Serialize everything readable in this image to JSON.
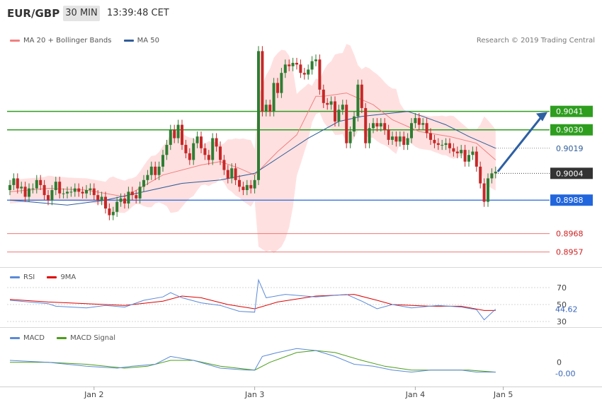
{
  "header": {
    "symbol": "EUR/GBP",
    "timeframe": "30 MIN",
    "time": "13:39:48 CET"
  },
  "legend": {
    "ma20": "MA 20 + Bollinger Bands",
    "ma50": "MA 50",
    "copyright": "Research © 2019 Trading Central"
  },
  "rsi_legend": {
    "rsi": "RSI",
    "ma9": "9MA"
  },
  "macd_legend": {
    "macd": "MACD",
    "signal": "MACD Signal"
  },
  "colors": {
    "up": "#2e7d32",
    "down": "#c62828",
    "ma20": "#f08080",
    "band": "#ffd6d6",
    "ma50": "#2f5c99",
    "green_level": "#2e9e1f",
    "red_level": "#ee7777",
    "support": "#2266dd",
    "arrow": "#2d5fa3",
    "rsi": "#5b8ad8",
    "rsi_ma": "#e00000",
    "macd": "#5b8ad8",
    "macd_signal": "#4c9e1a"
  },
  "chart_data": [
    {
      "type": "candlestick",
      "name": "EUR/GBP",
      "ylim": [
        0.8948,
        0.9078
      ],
      "x_tick_labels": [
        "Jan 2",
        "Jan 3",
        "Jan 4",
        "Jan 5"
      ],
      "levels": [
        {
          "value": 0.9041,
          "label": "0.9041",
          "style": "green"
        },
        {
          "value": 0.903,
          "label": "0.9030",
          "style": "green"
        },
        {
          "value": 0.9019,
          "label": "0.9019",
          "style": "dotted"
        },
        {
          "value": 0.9004,
          "label": "0.9004",
          "style": "current"
        },
        {
          "value": 0.8988,
          "label": "0.8988",
          "style": "support"
        },
        {
          "value": 0.8968,
          "label": "0.8968",
          "style": "red"
        },
        {
          "value": 0.8957,
          "label": "0.8957",
          "style": "red"
        }
      ],
      "closes": [
        0.8997,
        0.9001,
        0.8995,
        0.8996,
        0.899,
        0.8995,
        0.8995,
        0.9,
        0.8997,
        0.8991,
        0.8988,
        0.8994,
        0.8999,
        0.8992,
        0.8992,
        0.8993,
        0.8993,
        0.8995,
        0.8993,
        0.8992,
        0.8994,
        0.8995,
        0.8991,
        0.8988,
        0.899,
        0.8983,
        0.8979,
        0.8981,
        0.8987,
        0.8989,
        0.8986,
        0.8993,
        0.8991,
        0.8989,
        0.8996,
        0.9,
        0.9003,
        0.9008,
        0.9003,
        0.9008,
        0.9015,
        0.9021,
        0.903,
        0.9025,
        0.9033,
        0.9021,
        0.9016,
        0.9012,
        0.9022,
        0.9026,
        0.9019,
        0.9015,
        0.9012,
        0.9025,
        0.902,
        0.9012,
        0.9006,
        0.9001,
        0.9007,
        0.9,
        0.8996,
        0.8994,
        0.8997,
        0.8995,
        0.9,
        0.9077,
        0.9041,
        0.9045,
        0.9041,
        0.9058,
        0.9052,
        0.9064,
        0.9069,
        0.9068,
        0.907,
        0.9069,
        0.9064,
        0.9063,
        0.9066,
        0.9071,
        0.9072,
        0.9054,
        0.9046,
        0.9045,
        0.9047,
        0.9035,
        0.9042,
        0.9045,
        0.9022,
        0.9029,
        0.9038,
        0.9057,
        0.9043,
        0.9022,
        0.9031,
        0.9034,
        0.9032,
        0.9034,
        0.903,
        0.9024,
        0.9026,
        0.9023,
        0.9026,
        0.9021,
        0.9025,
        0.9034,
        0.9037,
        0.9033,
        0.9034,
        0.9028,
        0.9024,
        0.9022,
        0.9021,
        0.9021,
        0.9022,
        0.9019,
        0.9017,
        0.9016,
        0.9018,
        0.9011,
        0.9015,
        0.9017,
        0.9008,
        0.8998,
        0.8987,
        0.9001,
        0.9004,
        0.9005
      ],
      "ma20_points": [
        [
          0,
          0.8993
        ],
        [
          10,
          0.8995
        ],
        [
          20,
          0.8994
        ],
        [
          30,
          0.899
        ],
        [
          40,
          0.9003
        ],
        [
          50,
          0.9009
        ],
        [
          55,
          0.9011
        ],
        [
          60,
          0.9007
        ],
        [
          64,
          0.9003
        ],
        [
          70,
          0.9017
        ],
        [
          75,
          0.9027
        ],
        [
          80,
          0.905
        ],
        [
          82,
          0.905
        ],
        [
          88,
          0.9052
        ],
        [
          95,
          0.9045
        ],
        [
          100,
          0.9036
        ],
        [
          107,
          0.9029
        ],
        [
          115,
          0.9026
        ],
        [
          122,
          0.9022
        ],
        [
          127,
          0.9012
        ]
      ],
      "ma50_points": [
        [
          0,
          0.8988
        ],
        [
          15,
          0.8985
        ],
        [
          25,
          0.8988
        ],
        [
          35,
          0.8993
        ],
        [
          45,
          0.8998
        ],
        [
          55,
          0.9
        ],
        [
          64,
          0.9004
        ],
        [
          70,
          0.9013
        ],
        [
          78,
          0.9025
        ],
        [
          86,
          0.9035
        ],
        [
          92,
          0.9038
        ],
        [
          100,
          0.904
        ],
        [
          104,
          0.9041
        ],
        [
          108,
          0.9038
        ],
        [
          114,
          0.9033
        ],
        [
          120,
          0.9026
        ],
        [
          127,
          0.9019
        ]
      ]
    },
    {
      "type": "line",
      "name": "RSI",
      "ylim": [
        25,
        80
      ],
      "y_ticks": [
        30,
        50,
        70
      ],
      "current": "44.62",
      "rsi_points": [
        [
          0,
          55
        ],
        [
          10,
          51
        ],
        [
          12,
          48
        ],
        [
          20,
          46
        ],
        [
          25,
          49
        ],
        [
          30,
          47
        ],
        [
          35,
          55
        ],
        [
          40,
          59
        ],
        [
          42,
          64
        ],
        [
          45,
          58
        ],
        [
          50,
          52
        ],
        [
          55,
          49
        ],
        [
          60,
          42
        ],
        [
          64,
          41
        ],
        [
          65,
          79
        ],
        [
          67,
          58
        ],
        [
          72,
          62
        ],
        [
          80,
          59
        ],
        [
          88,
          62
        ],
        [
          92,
          54
        ],
        [
          96,
          45
        ],
        [
          100,
          50
        ],
        [
          105,
          46
        ],
        [
          112,
          49
        ],
        [
          118,
          47
        ],
        [
          122,
          44
        ],
        [
          124,
          32
        ],
        [
          127,
          44.62
        ]
      ],
      "ma_points": [
        [
          0,
          56
        ],
        [
          10,
          53
        ],
        [
          20,
          51
        ],
        [
          30,
          49
        ],
        [
          40,
          54
        ],
        [
          45,
          60
        ],
        [
          50,
          58
        ],
        [
          57,
          50
        ],
        [
          64,
          45
        ],
        [
          70,
          53
        ],
        [
          80,
          60
        ],
        [
          90,
          62
        ],
        [
          96,
          55
        ],
        [
          100,
          50
        ],
        [
          110,
          48
        ],
        [
          118,
          48
        ],
        [
          124,
          43
        ],
        [
          127,
          43
        ]
      ]
    },
    {
      "type": "line",
      "name": "MACD",
      "ylim": [
        -0.0012,
        0.001
      ],
      "y_ticks": [
        {
          "value": 0,
          "label": "0"
        }
      ],
      "current": "-0.00",
      "macd_points": [
        [
          0,
          0.0001
        ],
        [
          10,
          0
        ],
        [
          20,
          -0.0002
        ],
        [
          28,
          -0.0003
        ],
        [
          32,
          -0.0002
        ],
        [
          38,
          -0.0001
        ],
        [
          42,
          0.0003
        ],
        [
          45,
          0.0002
        ],
        [
          48,
          0.0001
        ],
        [
          55,
          -0.0003
        ],
        [
          62,
          -0.0004
        ],
        [
          64,
          -0.0004
        ],
        [
          66,
          0.0003
        ],
        [
          70,
          0.0005
        ],
        [
          75,
          0.0007
        ],
        [
          80,
          0.0006
        ],
        [
          85,
          0.0003
        ],
        [
          90,
          -0.0001
        ],
        [
          95,
          -0.0002
        ],
        [
          100,
          -0.0004
        ],
        [
          105,
          -0.0005
        ],
        [
          110,
          -0.0004
        ],
        [
          118,
          -0.0004
        ],
        [
          122,
          -0.0005
        ],
        [
          127,
          -0.0005
        ]
      ],
      "signal_points": [
        [
          0,
          0
        ],
        [
          10,
          0
        ],
        [
          20,
          -0.0001
        ],
        [
          30,
          -0.0003
        ],
        [
          36,
          -0.0002
        ],
        [
          42,
          0.0001
        ],
        [
          48,
          0.0001
        ],
        [
          55,
          -0.0002
        ],
        [
          64,
          -0.0004
        ],
        [
          68,
          0
        ],
        [
          75,
          0.0005
        ],
        [
          80,
          0.0006
        ],
        [
          85,
          0.0005
        ],
        [
          92,
          0.0001
        ],
        [
          98,
          -0.0002
        ],
        [
          105,
          -0.0004
        ],
        [
          112,
          -0.0004
        ],
        [
          120,
          -0.0004
        ],
        [
          127,
          -0.0005
        ]
      ]
    }
  ]
}
